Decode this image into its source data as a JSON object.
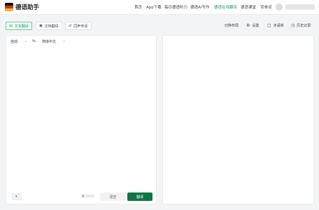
{
  "header": {
    "brand": "德语助手",
    "nav": [
      "首页",
      "App下载",
      "每日德语听力",
      "德语AI写作",
      "德语在线翻译",
      "德语课堂",
      "背单词"
    ],
    "active_nav": "德语在线翻译"
  },
  "toolbar": {
    "tabs": [
      {
        "label": "文本翻译",
        "icon": "text-icon"
      },
      {
        "label": "文档翻译",
        "icon": "document-icon"
      },
      {
        "label": "同声传译",
        "icon": "interpret-icon"
      }
    ],
    "layout_label": "切换布局",
    "settings_label": "设置",
    "glossary_label": "术语库",
    "history_label": "历史记录"
  },
  "source": {
    "lang_from": "自动",
    "lang_to": "简体中文",
    "char_count": "0",
    "char_limit": "/3500",
    "clear_label": "清空",
    "translate_label": "翻译"
  },
  "colors": {
    "accent": "#1a9b62",
    "primary_button": "#107547"
  }
}
